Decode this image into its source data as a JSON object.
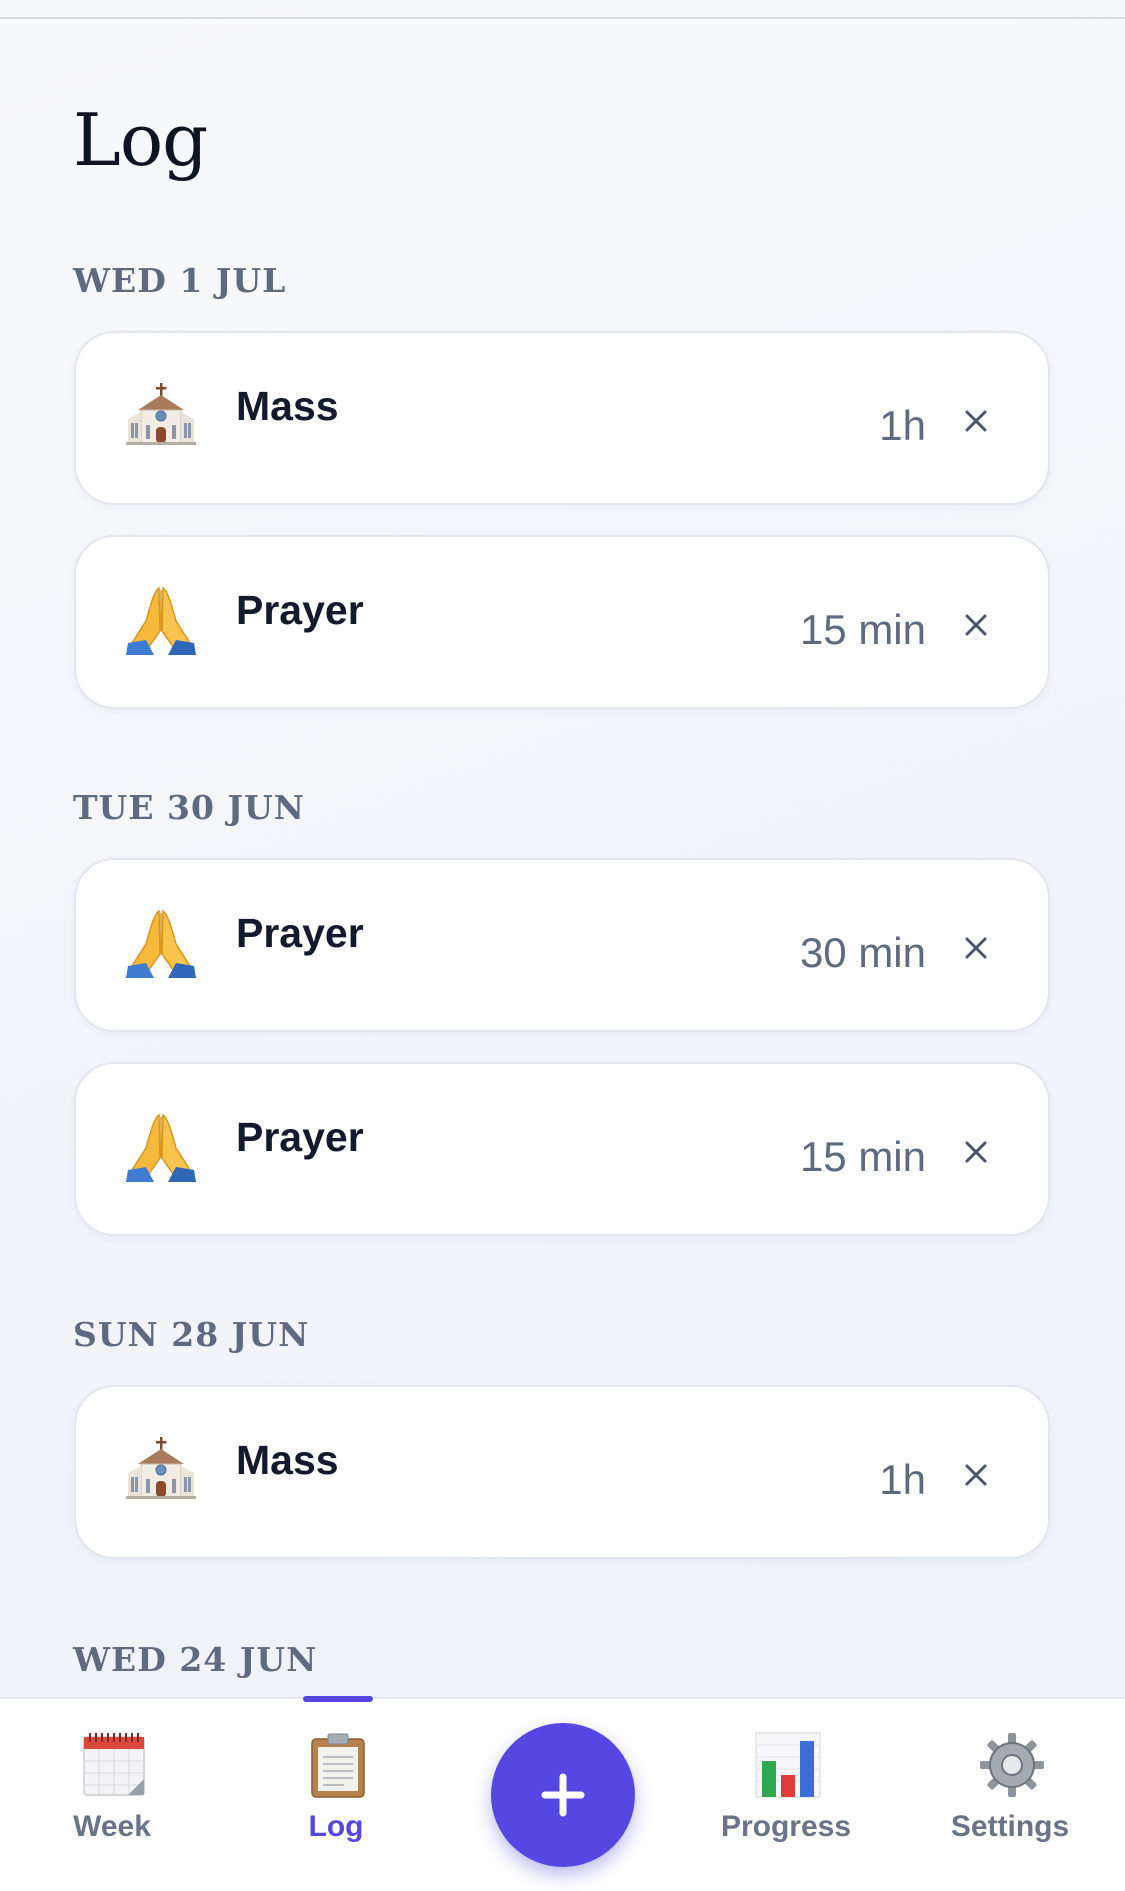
{
  "page": {
    "title": "Log"
  },
  "days": [
    {
      "label": "WED 1 JUL",
      "entries": [
        {
          "icon": "church-icon",
          "name": "Mass",
          "duration": "1h"
        },
        {
          "icon": "praying-hands-icon",
          "name": "Prayer",
          "duration": "15 min"
        }
      ]
    },
    {
      "label": "TUE 30 JUN",
      "entries": [
        {
          "icon": "praying-hands-icon",
          "name": "Prayer",
          "duration": "30 min"
        },
        {
          "icon": "praying-hands-icon",
          "name": "Prayer",
          "duration": "15 min"
        }
      ]
    },
    {
      "label": "SUN 28 JUN",
      "entries": [
        {
          "icon": "church-icon",
          "name": "Mass",
          "duration": "1h"
        }
      ]
    },
    {
      "label": "WED 24 JUN",
      "entries": []
    }
  ],
  "remove_glyph": "×",
  "nav": {
    "items": [
      {
        "label": "Week",
        "icon": "calendar-icon",
        "active": false
      },
      {
        "label": "Log",
        "icon": "clipboard-icon",
        "active": true
      },
      {
        "label": "Progress",
        "icon": "bar-chart-icon",
        "active": false
      },
      {
        "label": "Settings",
        "icon": "gear-icon",
        "active": false
      }
    ],
    "add_icon": "plus-icon"
  },
  "colors": {
    "accent": "#5548e2",
    "title_text": "#0f1424",
    "day_header_text": "#5d6a80",
    "duration_text": "#5e6a7e",
    "inactive_nav_text": "#6a7488",
    "card_background": "#ffffff"
  }
}
